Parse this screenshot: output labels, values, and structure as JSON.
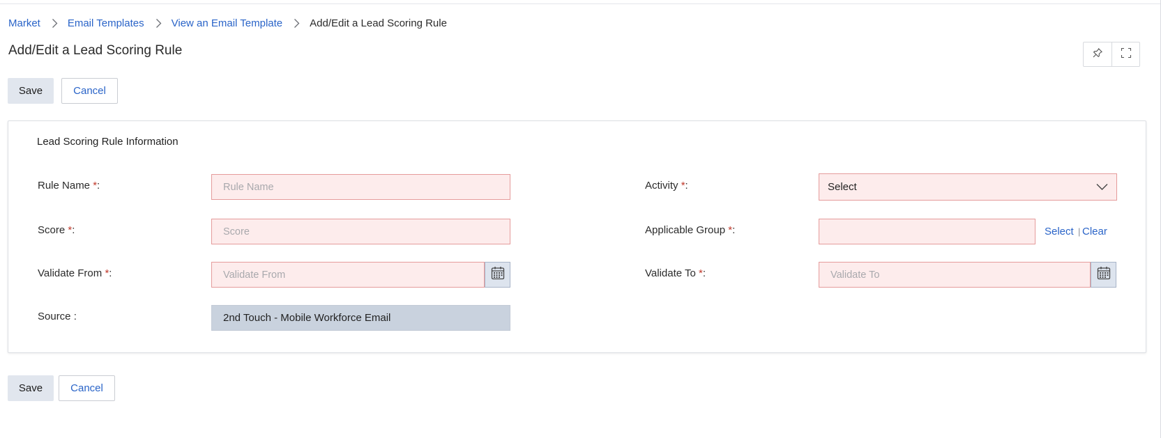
{
  "breadcrumb": {
    "items": [
      "Market",
      "Email Templates",
      "View an Email Template"
    ],
    "current": "Add/Edit a Lead Scoring Rule"
  },
  "page": {
    "title": "Add/Edit a Lead Scoring Rule"
  },
  "toolbar": {
    "save_label": "Save",
    "cancel_label": "Cancel"
  },
  "header_icons": [
    "pin-icon",
    "fullscreen-icon"
  ],
  "section": {
    "title": "Lead Scoring Rule Information",
    "required_marker": "*",
    "fields": {
      "rule_name": {
        "label": "Rule Name ",
        "suffix": ":",
        "placeholder": "Rule Name",
        "value": ""
      },
      "score": {
        "label": "Score  ",
        "suffix": ":",
        "placeholder": "Score",
        "value": ""
      },
      "validate_from": {
        "label": "Validate From  ",
        "suffix": ":",
        "placeholder": "Validate From",
        "value": ""
      },
      "source": {
        "label": "Source :",
        "value": "2nd Touch - Mobile Workforce Email"
      },
      "activity": {
        "label": "Activity ",
        "suffix": ":",
        "selected": "Select"
      },
      "applicable_group": {
        "label": "Applicable Group ",
        "suffix": ":",
        "value": "",
        "select_link": "Select",
        "separator": "|",
        "clear_link": "Clear"
      },
      "validate_to": {
        "label": "Validate To  ",
        "suffix": ":",
        "placeholder": "Validate To",
        "value": ""
      }
    }
  },
  "footer": {
    "save_label": "Save",
    "cancel_label": "Cancel"
  },
  "colors": {
    "link": "#2a64c8",
    "required": "#c0392b",
    "invalid_field_bg": "#fdecec",
    "invalid_field_border": "#e59b9b",
    "readonly_bg": "#c9d2de",
    "save_button_bg": "#e1e6ee"
  }
}
